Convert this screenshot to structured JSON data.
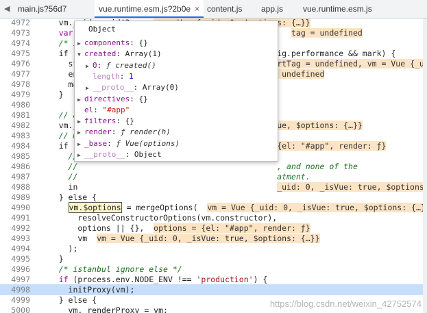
{
  "tabs": [
    {
      "label": "main.js?56d7",
      "active": false
    },
    {
      "label": "vue.runtime.esm.js?2b0e",
      "active": true
    },
    {
      "label": "content.js",
      "active": false
    },
    {
      "label": "app.js",
      "active": false
    },
    {
      "label": "vue.runtime.esm.js",
      "active": false
    }
  ],
  "tab_close": "×",
  "lines": [
    {
      "num": "4972",
      "parts": [
        {
          "t": "    vm._uid = uid$3++;  ",
          "c": ""
        },
        {
          "t": "vm = Vue {_uid: 0, $options: {…}}",
          "c": "inl"
        }
      ]
    },
    {
      "num": "4973",
      "parts": [
        {
          "t": "    var",
          "c": "kw"
        },
        {
          "t": "                                              ",
          "c": ""
        },
        {
          "t": "tag = undefined",
          "c": "inl"
        }
      ]
    },
    {
      "num": "4974",
      "parts": [
        {
          "t": "    /* i",
          "c": "cm"
        }
      ]
    },
    {
      "num": "4975",
      "parts": [
        {
          "t": "    if (",
          "c": ""
        },
        {
          "t": "                                          ig.performance && mark) {",
          "c": ""
        }
      ]
    },
    {
      "num": "4976",
      "parts": [
        {
          "t": "      st",
          "c": ""
        },
        {
          "t": "                                          ",
          "c": ""
        },
        {
          "t": "rtTag = undefined, vm = Vue {_uid:",
          "c": "inl"
        }
      ]
    },
    {
      "num": "4977",
      "parts": [
        {
          "t": "      en",
          "c": ""
        },
        {
          "t": "                                          ",
          "c": ""
        },
        {
          "t": " undefined",
          "c": "inl"
        }
      ]
    },
    {
      "num": "4978",
      "parts": [
        {
          "t": "      ma",
          "c": ""
        }
      ]
    },
    {
      "num": "4979",
      "parts": [
        {
          "t": "    }",
          "c": ""
        }
      ]
    },
    {
      "num": "4980",
      "parts": [
        {
          "t": "",
          "c": ""
        }
      ]
    },
    {
      "num": "4981",
      "parts": [
        {
          "t": "    // a",
          "c": "cm"
        }
      ]
    },
    {
      "num": "4982",
      "parts": [
        {
          "t": "    vm._",
          "c": ""
        },
        {
          "t": "                                          ",
          "c": ""
        },
        {
          "t": "ue, $options: {…}}",
          "c": "inl"
        }
      ]
    },
    {
      "num": "4983",
      "parts": [
        {
          "t": "    // m",
          "c": "cm"
        }
      ]
    },
    {
      "num": "4984",
      "parts": [
        {
          "t": "    if (",
          "c": ""
        },
        {
          "t": "                                          ",
          "c": ""
        },
        {
          "t": "{el: \"#app\", render: ƒ}",
          "c": "inl"
        }
      ]
    },
    {
      "num": "4985",
      "parts": [
        {
          "t": "      //",
          "c": "cm"
        }
      ]
    },
    {
      "num": "4986",
      "parts": [
        {
          "t": "      //",
          "c": "cm"
        },
        {
          "t": "                                          , and none of the",
          "c": "cm"
        }
      ]
    },
    {
      "num": "4987",
      "parts": [
        {
          "t": "      //",
          "c": "cm"
        },
        {
          "t": "                                          atment.",
          "c": "cm"
        }
      ]
    },
    {
      "num": "4988",
      "parts": [
        {
          "t": "      in",
          "c": ""
        },
        {
          "t": "                                          ",
          "c": ""
        },
        {
          "t": "_uid: 0, _isVue: true, $options:",
          "c": "inl"
        }
      ]
    },
    {
      "num": "4989",
      "parts": [
        {
          "t": "    } else {",
          "c": ""
        }
      ]
    },
    {
      "num": "4990",
      "parts": [
        {
          "t": "      ",
          "c": ""
        },
        {
          "t": "vm.$options",
          "c": "boxed"
        },
        {
          "t": " = mergeOptions(  ",
          "c": ""
        },
        {
          "t": "vm = Vue {_uid: 0, _isVue: true, $options: {…}}",
          "c": "inl"
        }
      ]
    },
    {
      "num": "4991",
      "parts": [
        {
          "t": "        resolveConstructorOptions(vm.constructor),",
          "c": ""
        }
      ]
    },
    {
      "num": "4992",
      "parts": [
        {
          "t": "        options || {},  ",
          "c": ""
        },
        {
          "t": "options = {el: \"#app\", render: ƒ}",
          "c": "inl"
        }
      ]
    },
    {
      "num": "4993",
      "parts": [
        {
          "t": "        vm  ",
          "c": ""
        },
        {
          "t": "vm = Vue {_uid: 0, _isVue: true, $options: {…}}",
          "c": "inl"
        }
      ]
    },
    {
      "num": "4994",
      "parts": [
        {
          "t": "      );",
          "c": ""
        }
      ]
    },
    {
      "num": "4995",
      "parts": [
        {
          "t": "    }",
          "c": ""
        }
      ]
    },
    {
      "num": "4996",
      "parts": [
        {
          "t": "    /* istanbul ignore else */",
          "c": "cm"
        }
      ]
    },
    {
      "num": "4997",
      "parts": [
        {
          "t": "    if ",
          "c": "kw"
        },
        {
          "t": "(process.env.NODE_ENV !== ",
          "c": ""
        },
        {
          "t": "'production'",
          "c": "str"
        },
        {
          "t": ") {",
          "c": ""
        }
      ]
    },
    {
      "num": "4998",
      "hl": true,
      "parts": [
        {
          "t": "      initProxy(vm);",
          "c": ""
        }
      ]
    },
    {
      "num": "4999",
      "parts": [
        {
          "t": "    } else {",
          "c": ""
        }
      ]
    },
    {
      "num": "5000",
      "parts": [
        {
          "t": "      vm._renderProxy = vm;",
          "c": ""
        }
      ]
    },
    {
      "num": "5001",
      "parts": [
        {
          "t": "    }",
          "c": ""
        }
      ]
    }
  ],
  "popup": {
    "title": "Object",
    "rows": [
      {
        "indent": 0,
        "tri": "▶",
        "parts": [
          {
            "t": "components",
            "c": "prop"
          },
          {
            "t": ": {}",
            "c": ""
          }
        ]
      },
      {
        "indent": 0,
        "tri": "▼",
        "parts": [
          {
            "t": "created",
            "c": "prop"
          },
          {
            "t": ": Array(1)",
            "c": ""
          }
        ]
      },
      {
        "indent": 1,
        "tri": "▶",
        "parts": [
          {
            "t": "0",
            "c": "prop"
          },
          {
            "t": ": ",
            "c": ""
          },
          {
            "t": "ƒ created()",
            "c": "fn"
          }
        ]
      },
      {
        "indent": 1,
        "tri": "",
        "parts": [
          {
            "t": "length",
            "c": "dim"
          },
          {
            "t": ": ",
            "c": ""
          },
          {
            "t": "1",
            "c": "num"
          }
        ]
      },
      {
        "indent": 1,
        "tri": "▶",
        "parts": [
          {
            "t": "__proto__",
            "c": "dim"
          },
          {
            "t": ": Array(0)",
            "c": ""
          }
        ]
      },
      {
        "indent": 0,
        "tri": "▶",
        "parts": [
          {
            "t": "directives",
            "c": "prop"
          },
          {
            "t": ": {}",
            "c": ""
          }
        ]
      },
      {
        "indent": 0,
        "tri": "",
        "parts": [
          {
            "t": "el",
            "c": "prop"
          },
          {
            "t": ": ",
            "c": ""
          },
          {
            "t": "\"#app\"",
            "c": "sval"
          }
        ]
      },
      {
        "indent": 0,
        "tri": "▶",
        "parts": [
          {
            "t": "filters",
            "c": "prop"
          },
          {
            "t": ": {}",
            "c": ""
          }
        ]
      },
      {
        "indent": 0,
        "tri": "▶",
        "parts": [
          {
            "t": "render",
            "c": "prop"
          },
          {
            "t": ": ",
            "c": ""
          },
          {
            "t": "ƒ render(h)",
            "c": "fn"
          }
        ]
      },
      {
        "indent": 0,
        "tri": "▶",
        "parts": [
          {
            "t": "_base",
            "c": "prop"
          },
          {
            "t": ": ",
            "c": ""
          },
          {
            "t": "ƒ Vue(options)",
            "c": "fn"
          }
        ]
      },
      {
        "indent": 0,
        "tri": "▶",
        "parts": [
          {
            "t": "__proto__",
            "c": "dim"
          },
          {
            "t": ": Object",
            "c": ""
          }
        ]
      }
    ]
  },
  "watermark": "https://blog.csdn.net/weixin_42752574"
}
